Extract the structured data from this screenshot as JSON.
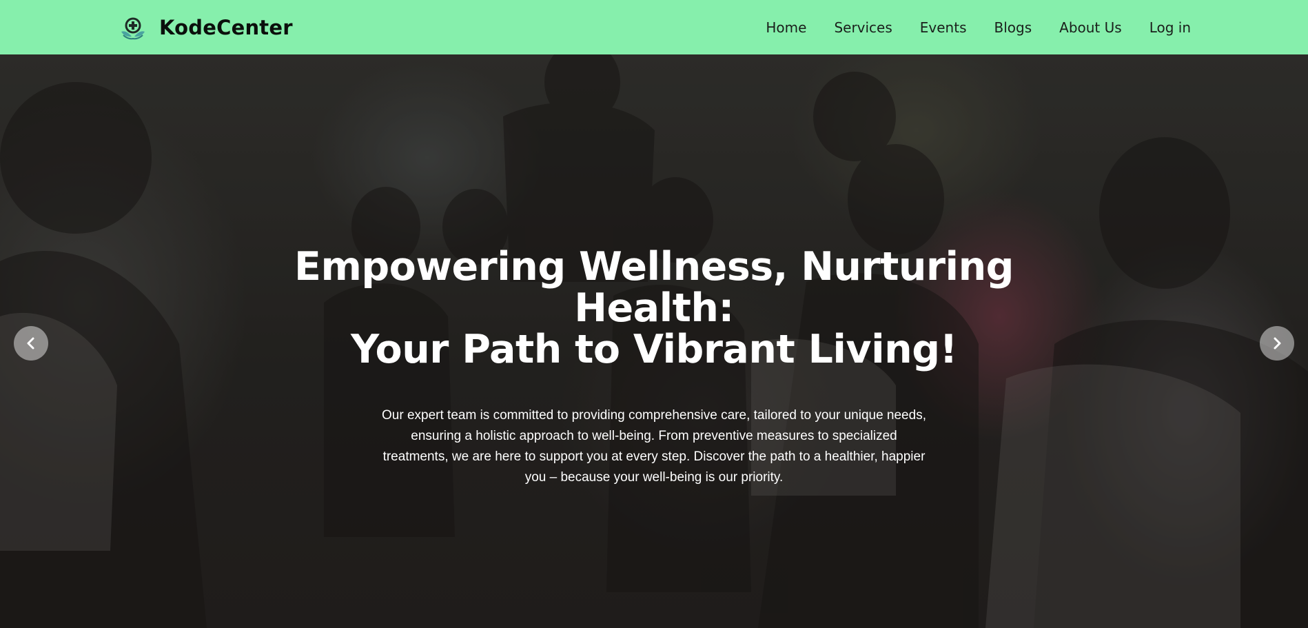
{
  "brand": {
    "name": "KodeCenter",
    "logo_icon": "medical-cross-hands-icon"
  },
  "nav": {
    "items": [
      {
        "label": "Home"
      },
      {
        "label": "Services"
      },
      {
        "label": "Events"
      },
      {
        "label": "Blogs"
      },
      {
        "label": "About Us"
      },
      {
        "label": "Log in"
      }
    ]
  },
  "hero": {
    "title_line1": "Empowering Wellness, Nurturing Health:",
    "title_line2": "Your Path to Vibrant Living!",
    "description": "Our expert team is committed to providing comprehensive care, tailored to your unique needs, ensuring a holistic approach to well-being. From preventive measures to specialized treatments, we are here to support you at every step. Discover the path to a healthier, happier you – because your well-being is our priority.",
    "prev_icon": "chevron-left-icon",
    "next_icon": "chevron-right-icon"
  },
  "colors": {
    "navbar_bg": "#86efac",
    "brand_text": "#0b0f0c",
    "hero_text": "#ffffff"
  }
}
